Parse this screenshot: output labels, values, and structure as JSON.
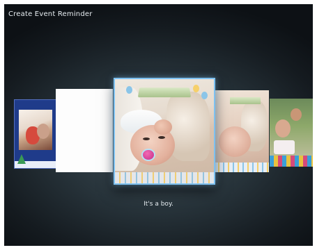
{
  "screen": {
    "title": "Create Event Reminder"
  },
  "carousel": {
    "selected_caption": "It's a boy.",
    "selected_index": 2,
    "highlight_color": "#7ec1f0",
    "cards": [
      {
        "id": "christmas-template",
        "icon": "christmas-photo-thumbnail"
      },
      {
        "id": "blank-template",
        "icon": "blank-thumbnail"
      },
      {
        "id": "its-a-boy-template",
        "icon": "baby-photo-thumbnail"
      },
      {
        "id": "baby-variant-template",
        "icon": "baby-photo-thumbnail"
      },
      {
        "id": "birthday-template",
        "icon": "birthday-photo-thumbnail"
      }
    ]
  }
}
